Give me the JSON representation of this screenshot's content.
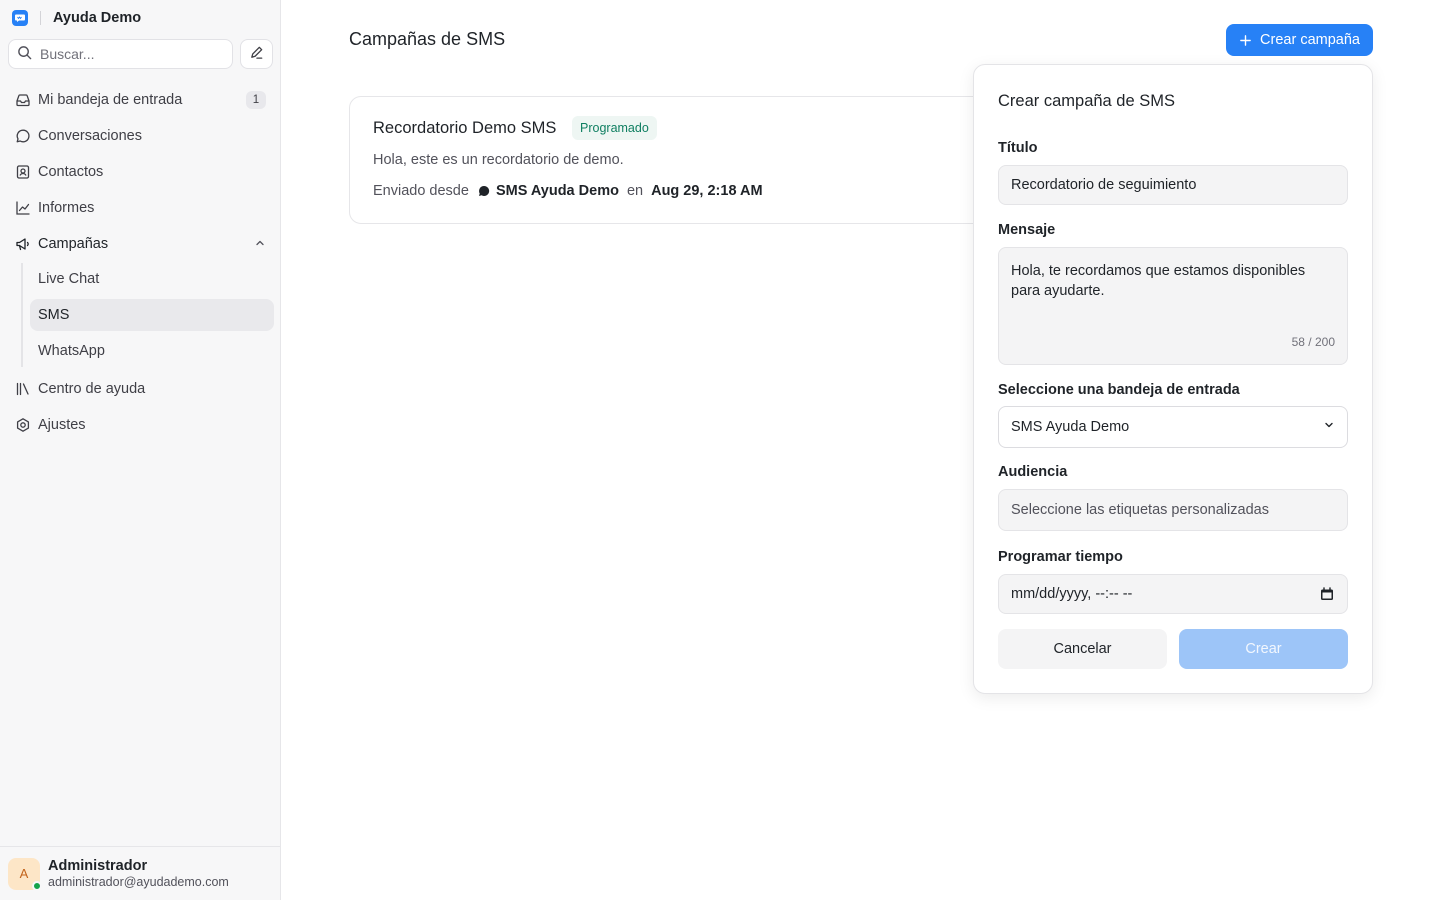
{
  "brand": {
    "name": "Ayuda Demo",
    "logo_icon": "chat-logo-icon"
  },
  "search": {
    "placeholder": "Buscar..."
  },
  "sidebar": {
    "items": [
      {
        "label": "Mi bandeja de entrada",
        "icon": "inbox-icon",
        "badge": "1"
      },
      {
        "label": "Conversaciones",
        "icon": "chat-bubble-icon"
      },
      {
        "label": "Contactos",
        "icon": "contact-book-icon"
      },
      {
        "label": "Informes",
        "icon": "chart-line-icon"
      },
      {
        "label": "Campañas",
        "icon": "megaphone-icon",
        "expanded": true,
        "children": [
          {
            "label": "Live Chat"
          },
          {
            "label": "SMS",
            "active": true
          },
          {
            "label": "WhatsApp"
          }
        ]
      },
      {
        "label": "Centro de ayuda",
        "icon": "library-icon"
      },
      {
        "label": "Ajustes",
        "icon": "settings-icon"
      }
    ]
  },
  "user": {
    "initial": "A",
    "name": "Administrador",
    "email": "administrador@ayudademo.com",
    "status_color": "#16a34a"
  },
  "main": {
    "title": "Campañas de SMS",
    "create_button": "Crear campaña",
    "campaign": {
      "title": "Recordatorio Demo SMS",
      "status": "Programado",
      "message": "Hola, este es un recordatorio de demo.",
      "sent_from_label": "Enviado desde",
      "inbox": "SMS Ayuda Demo",
      "at_label": "en",
      "date": "Aug 29, 2:18 AM"
    }
  },
  "form": {
    "title": "Crear campaña de SMS",
    "title_label": "Título",
    "title_value": "Recordatorio de seguimiento",
    "message_label": "Mensaje",
    "message_value": "Hola, te recordamos que estamos disponibles para ayudarte.",
    "message_counter": "58 / 200",
    "inbox_label": "Seleccione una bandeja de entrada",
    "inbox_value": "SMS Ayuda Demo",
    "audience_label": "Audiencia",
    "audience_placeholder": "Seleccione las etiquetas personalizadas",
    "schedule_label": "Programar tiempo",
    "schedule_placeholder": "mm/dd/yyyy, --:-- --",
    "cancel_label": "Cancelar",
    "create_label": "Crear"
  },
  "colors": {
    "accent": "#2781f6",
    "status_green": "#0f7f61",
    "disabled_accent": "#9dc5f8"
  }
}
